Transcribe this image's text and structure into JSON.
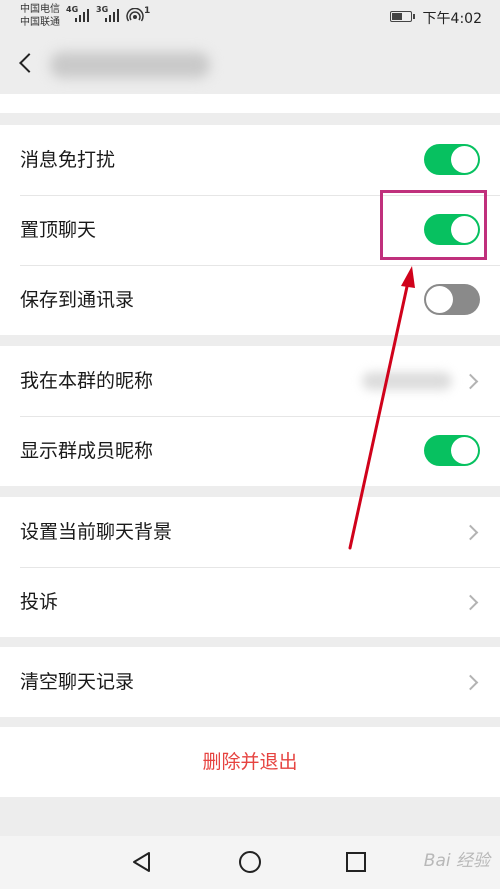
{
  "status_bar": {
    "carrier1": "中国电信",
    "carrier2": "中国联通",
    "net1": "4G",
    "net2": "3G",
    "hotspot_badge": "1",
    "time": "下午4:02"
  },
  "groups": {
    "g1": {
      "mute": {
        "label": "消息免打扰",
        "on": true
      },
      "pin": {
        "label": "置顶聊天",
        "on": true
      },
      "save": {
        "label": "保存到通讯录",
        "on": false
      }
    },
    "g2": {
      "nickname": {
        "label": "我在本群的昵称"
      },
      "show_names": {
        "label": "显示群成员昵称",
        "on": true
      }
    },
    "g3": {
      "background": {
        "label": "设置当前聊天背景"
      },
      "complain": {
        "label": "投诉"
      }
    },
    "g4": {
      "clear": {
        "label": "清空聊天记录"
      }
    },
    "g5": {
      "delete": {
        "label": "删除并退出"
      }
    }
  },
  "colors": {
    "toggle_on": "#07c160",
    "toggle_off": "#8a8a8a",
    "danger": "#e64340",
    "highlight": "#c0307c",
    "arrow": "#d0021b"
  },
  "watermark": "Bai 经验"
}
